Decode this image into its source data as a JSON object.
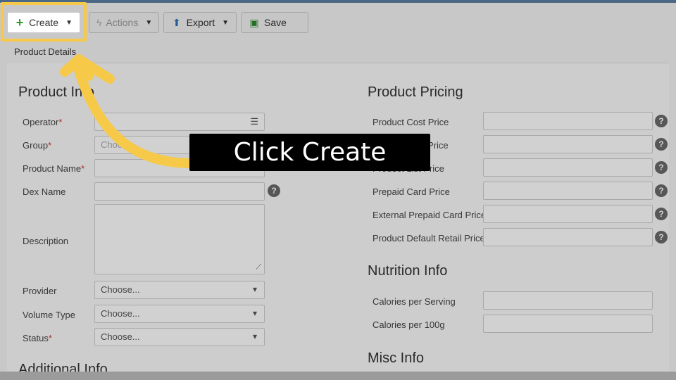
{
  "toolbar": {
    "create_label": "Create",
    "actions_label": "Actions",
    "export_label": "Export",
    "save_label": "Save"
  },
  "tabs": [
    {
      "label": "Product Details"
    }
  ],
  "product_info": {
    "title": "Product Info",
    "operator_label": "Operator",
    "group_label": "Group",
    "group_placeholder": "Choose...",
    "product_name_label": "Product Name",
    "dex_name_label": "Dex Name",
    "description_label": "Description",
    "provider_label": "Provider",
    "volume_type_label": "Volume Type",
    "status_label": "Status",
    "choose": "Choose...",
    "required_mark": "*"
  },
  "additional_info": {
    "title": "Additional Info"
  },
  "pricing": {
    "title": "Product Pricing",
    "fields": [
      "Product Cost Price",
      "Product Sale Price",
      "Product List Price",
      "Prepaid Card Price",
      "External Prepaid Card Price",
      "Product Default Retail Price"
    ]
  },
  "nutrition": {
    "title": "Nutrition Info",
    "fields": [
      "Calories per Serving",
      "Calories per 100g"
    ]
  },
  "misc": {
    "title": "Misc Info"
  },
  "callout": {
    "text": "Click Create"
  },
  "colors": {
    "highlight": "#f7c948",
    "arrow": "#f7c948",
    "callout_bg": "#000000"
  }
}
